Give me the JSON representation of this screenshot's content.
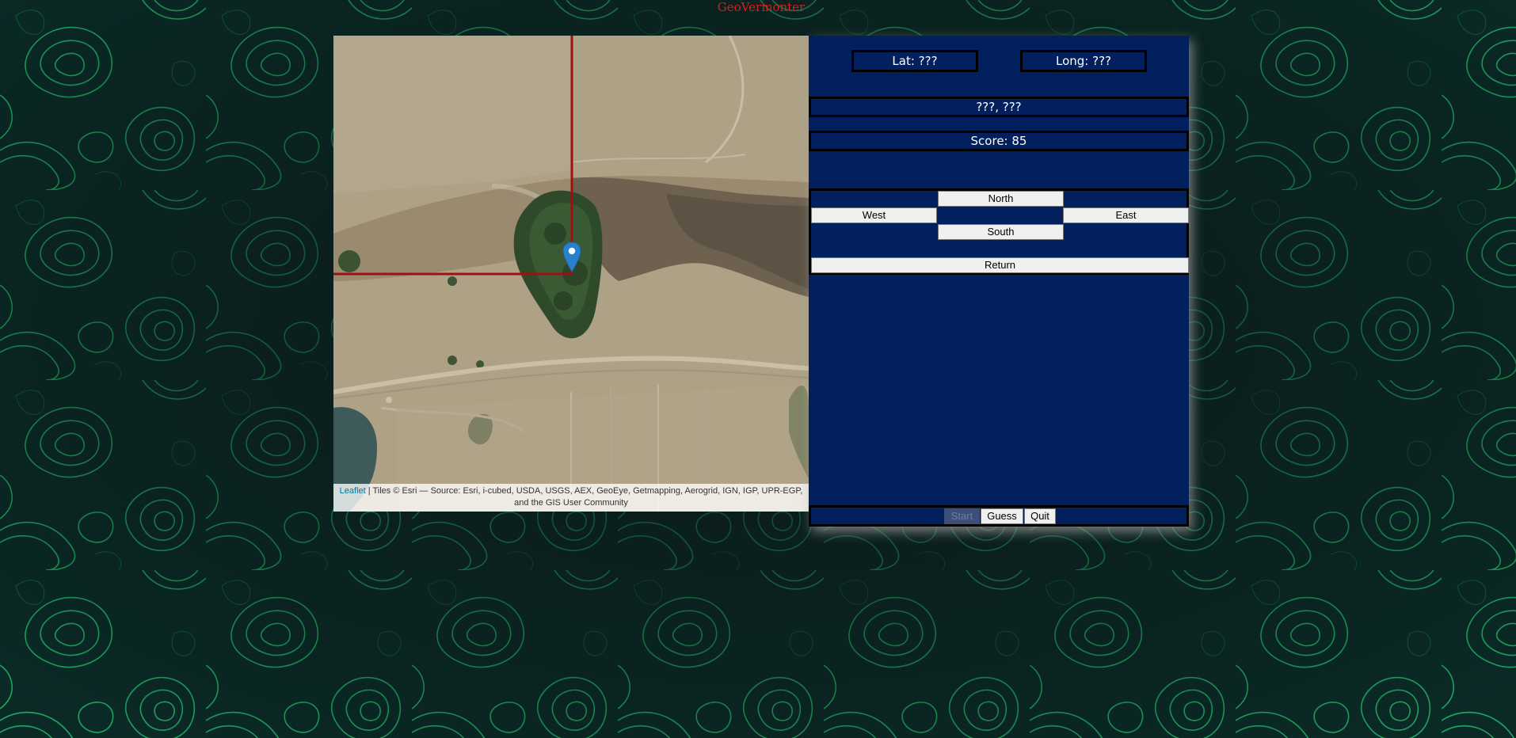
{
  "page": {
    "title": "GeoVermonter",
    "title_color": "#e21b1b",
    "background_color": "#0a1a1c",
    "contour_color": "#1fbf6a"
  },
  "map": {
    "marker_icon": "map-pin-icon",
    "marker_color": "#2a81cb",
    "boundary_line_color": "#a01010",
    "attribution_link": "Leaflet",
    "attribution_text": " | Tiles © Esri — Source: Esri, i-cubed, USDA, USGS, AEX, GeoEye, Getmapping, Aerogrid, IGN, IGP, UPR-EGP, and the GIS User Community"
  },
  "panel": {
    "background_color": "#02205e",
    "lat_label": "Lat: ???",
    "long_label": "Long: ???",
    "coords_label": "???, ???",
    "score_label": "Score: 85",
    "directions": {
      "north": "North",
      "west": "West",
      "east": "East",
      "south": "South",
      "return": "Return"
    },
    "controls": {
      "start": "Start",
      "start_disabled": true,
      "guess": "Guess",
      "quit": "Quit"
    }
  }
}
